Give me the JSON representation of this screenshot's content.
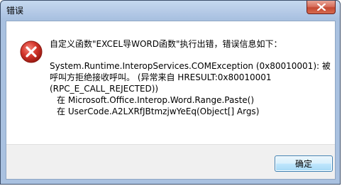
{
  "window": {
    "title": "错误",
    "close_icon": "close-icon"
  },
  "dialog": {
    "icon": "error-icon",
    "header": "自定义函数\"EXCEL导WORD函数\"执行出错，错误信息如下：",
    "detail_lines": [
      "System.Runtime.InteropServices.COMException (0x80010001): 被",
      "呼叫方拒绝接收呼叫。 (异常来自 HRESULT:0x80010001",
      "(RPC_E_CALL_REJECTED))",
      "在 Microsoft.Office.Interop.Word.Range.Paste()",
      "在 UserCode.A2LXRfJBtmzjwYeEq(Object[] Args)"
    ]
  },
  "buttons": {
    "ok_label": "确定"
  },
  "colors": {
    "error_red": "#d3362c",
    "button_border": "#3c7fb1"
  }
}
